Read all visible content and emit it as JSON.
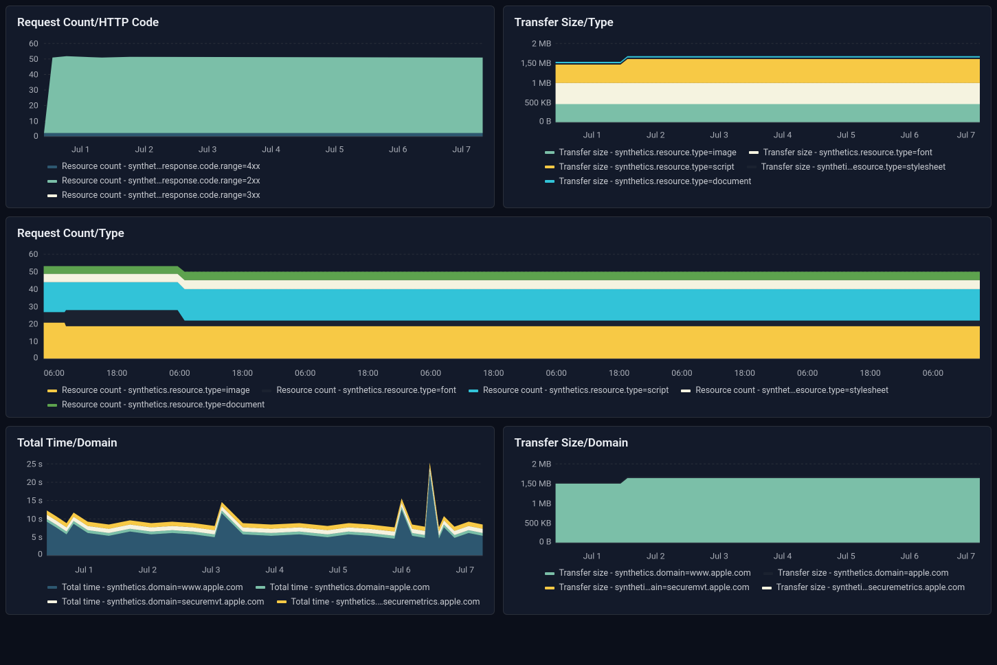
{
  "panels": {
    "p1": {
      "title": "Request Count/HTTP Code"
    },
    "p2": {
      "title": "Transfer Size/Type"
    },
    "p3": {
      "title": "Request Count/Type"
    },
    "p4": {
      "title": "Total Time/Domain"
    },
    "p5": {
      "title": "Transfer Size/Domain"
    }
  },
  "colors": {
    "teal": "#7bbfa8",
    "darkblue": "#2d5770",
    "cream": "#f5f3e0",
    "yellow": "#f7c945",
    "cyan": "#32c3d8",
    "green": "#5da24e",
    "dark": "#1b2230"
  },
  "chart_data": [
    {
      "id": "p1",
      "type": "area",
      "title": "Request Count/HTTP Code",
      "stacked": true,
      "ylim": [
        0,
        60
      ],
      "yticks": [
        0,
        10,
        20,
        30,
        40,
        50,
        60
      ],
      "xticks": [
        "Jul 1",
        "Jul 2",
        "Jul 3",
        "Jul 4",
        "Jul 5",
        "Jul 6",
        "Jul 7"
      ],
      "series": [
        {
          "name": "Resource count - synthet…response.code.range=4xx",
          "color": "#2d5770",
          "value_approx": 2
        },
        {
          "name": "Resource count - synthet…response.code.range=2xx",
          "color": "#7bbfa8",
          "value_approx": 50
        },
        {
          "name": "Resource count - synthet…response.code.range=3xx",
          "color": "#f5f3e0",
          "value_approx": 0
        }
      ]
    },
    {
      "id": "p2",
      "type": "area",
      "title": "Transfer Size/Type",
      "stacked": true,
      "ylim_bytes": [
        0,
        2097152
      ],
      "yticks_labels": [
        "0 B",
        "500 KB",
        "1 MB",
        "1,50 MB",
        "2 MB"
      ],
      "xticks": [
        "Jul 1",
        "Jul 2",
        "Jul 3",
        "Jul 4",
        "Jul 5",
        "Jul 6",
        "Jul 7"
      ],
      "series": [
        {
          "name": "Transfer size - synthetics.resource.type=image",
          "color": "#7bbfa8",
          "value_kb_approx": 480
        },
        {
          "name": "Transfer size - synthetics.resource.type=font",
          "color": "#f5f3e0",
          "value_kb_approx": 560
        },
        {
          "name": "Transfer size - synthetics.resource.type=script",
          "color": "#f7c945",
          "value_kb_approx": 520
        },
        {
          "name": "Transfer size - syntheti…esource.type=stylesheet",
          "color": "#1b2230",
          "value_kb_approx": 30
        },
        {
          "name": "Transfer size - synthetics.resource.type=document",
          "color": "#32c3d8",
          "value_kb_approx": 30
        }
      ],
      "note": "stack rises from ~1500KB to ~1650KB around Jul 1–2"
    },
    {
      "id": "p3",
      "type": "area",
      "title": "Request Count/Type",
      "stacked": true,
      "ylim": [
        0,
        60
      ],
      "yticks": [
        0,
        10,
        20,
        30,
        40,
        50,
        60
      ],
      "xticks": [
        "06:00",
        "18:00",
        "06:00",
        "18:00",
        "06:00",
        "18:00",
        "06:00",
        "18:00",
        "06:00",
        "18:00",
        "06:00",
        "18:00",
        "06:00",
        "18:00",
        "06:00"
      ],
      "series": [
        {
          "name": "Resource count - synthetics.resource.type=image",
          "color": "#f7c945",
          "value_approx": 19
        },
        {
          "name": "Resource count - synthetics.resource.type=font",
          "color": "#1b2230",
          "value_approx_early": 8,
          "value_approx_late": 3
        },
        {
          "name": "Resource count - synthetics.resource.type=script",
          "color": "#32c3d8",
          "value_approx": 18
        },
        {
          "name": "Resource count - synthet…esource.type=stylesheet",
          "color": "#f5f3e0",
          "value_approx": 5
        },
        {
          "name": "Resource count - synthetics.resource.type=document",
          "color": "#5da24e",
          "value_approx": 5
        }
      ]
    },
    {
      "id": "p4",
      "type": "area",
      "title": "Total Time/Domain",
      "stacked": true,
      "ylim": [
        0,
        25
      ],
      "yticks_labels": [
        "0",
        "5 s",
        "10 s",
        "15 s",
        "20 s",
        "25 s"
      ],
      "xticks": [
        "Jul 1",
        "Jul 2",
        "Jul 3",
        "Jul 4",
        "Jul 5",
        "Jul 6",
        "Jul 7"
      ],
      "series": [
        {
          "name": "Total time - synthetics.domain=www.apple.com",
          "color": "#2d5770",
          "baseline_s": 6
        },
        {
          "name": "Total time - synthetics.domain=apple.com",
          "color": "#7bbfa8",
          "baseline_s": 0.5
        },
        {
          "name": "Total time - synthetics.domain=securemvt.apple.com",
          "color": "#f5f3e0",
          "baseline_s": 1
        },
        {
          "name": "Total time - synthetics.…securemetrics.apple.com",
          "color": "#f7c945",
          "baseline_s": 1
        }
      ],
      "spikes_s": [
        12,
        10,
        11,
        23,
        13
      ]
    },
    {
      "id": "p5",
      "type": "area",
      "title": "Transfer Size/Domain",
      "stacked": true,
      "ylim_bytes": [
        0,
        2097152
      ],
      "yticks_labels": [
        "0 B",
        "500 KB",
        "1 MB",
        "1,50 MB",
        "2 MB"
      ],
      "xticks": [
        "Jul 1",
        "Jul 2",
        "Jul 3",
        "Jul 4",
        "Jul 5",
        "Jul 6",
        "Jul 7"
      ],
      "series": [
        {
          "name": "Transfer size - synthetics.domain=www.apple.com",
          "color": "#7bbfa8",
          "value_kb_early": 1500,
          "value_kb_late": 1650
        },
        {
          "name": "Transfer size - synthetics.domain=apple.com",
          "color": "#1b2230",
          "value_kb": 20
        },
        {
          "name": "Transfer size - syntheti…ain=securemvt.apple.com",
          "color": "#f7c945",
          "value_kb": 5
        },
        {
          "name": "Transfer size - syntheti…securemetrics.apple.com",
          "color": "#f5f3e0",
          "value_kb": 5
        }
      ]
    }
  ]
}
